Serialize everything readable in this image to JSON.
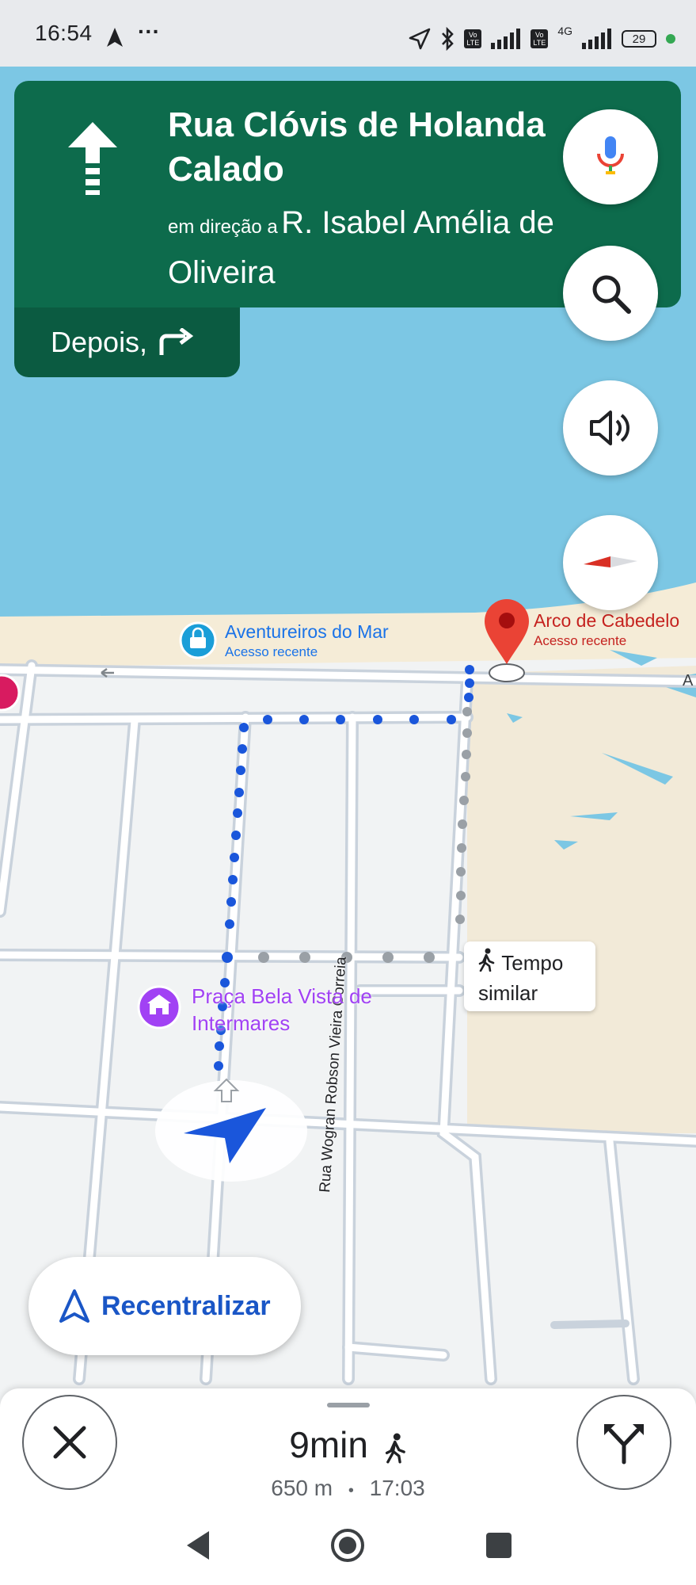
{
  "status_bar": {
    "time": "16:54",
    "more": "···",
    "battery": "29",
    "network": "4G",
    "volte_1": "Vo LTE",
    "volte_2": "Vo LTE"
  },
  "navigation": {
    "maneuver_icon": "straight-arrow",
    "street_name": "Rua Clóvis de Holanda Calado",
    "towards_prefix": "em direção a",
    "towards_street": "R. Isabel Amélia de Oliveira",
    "then_label": "Depois,",
    "then_icon": "turn-right-arrow"
  },
  "map": {
    "places": [
      {
        "name": "Aventureiros do Mar",
        "subtitle": "Acesso recente",
        "icon": "shopping-bag-icon"
      },
      {
        "name": "Arco de Cabedelo",
        "subtitle": "Acesso recente",
        "icon": "red-pin-icon"
      },
      {
        "name": "Praça Bela Vista de Intermares",
        "icon": "monument-icon"
      }
    ],
    "street_label": "Rua Wogran Robson Vieira Correia",
    "edge_label": "A",
    "alt_route_tip": "Tempo similar",
    "colors": {
      "water": "#7cc7e4",
      "sand": "#f5ecd7",
      "land": "#f1f3f4",
      "road": "#c9d2dc",
      "route": "#1a56db",
      "route_alt": "#9aa0a6",
      "banner": "#0d6b4c",
      "banner_dark": "#0b5b41"
    }
  },
  "controls": {
    "voice_icon": "mic-icon",
    "search_icon": "search-icon",
    "sound_icon": "volume-icon",
    "compass_icon": "compass-icon",
    "recenter_label": "Recentralizar"
  },
  "trip": {
    "duration": "9min",
    "mode": "walking",
    "distance": "650 m",
    "separator": "•",
    "arrival": "17:03"
  }
}
